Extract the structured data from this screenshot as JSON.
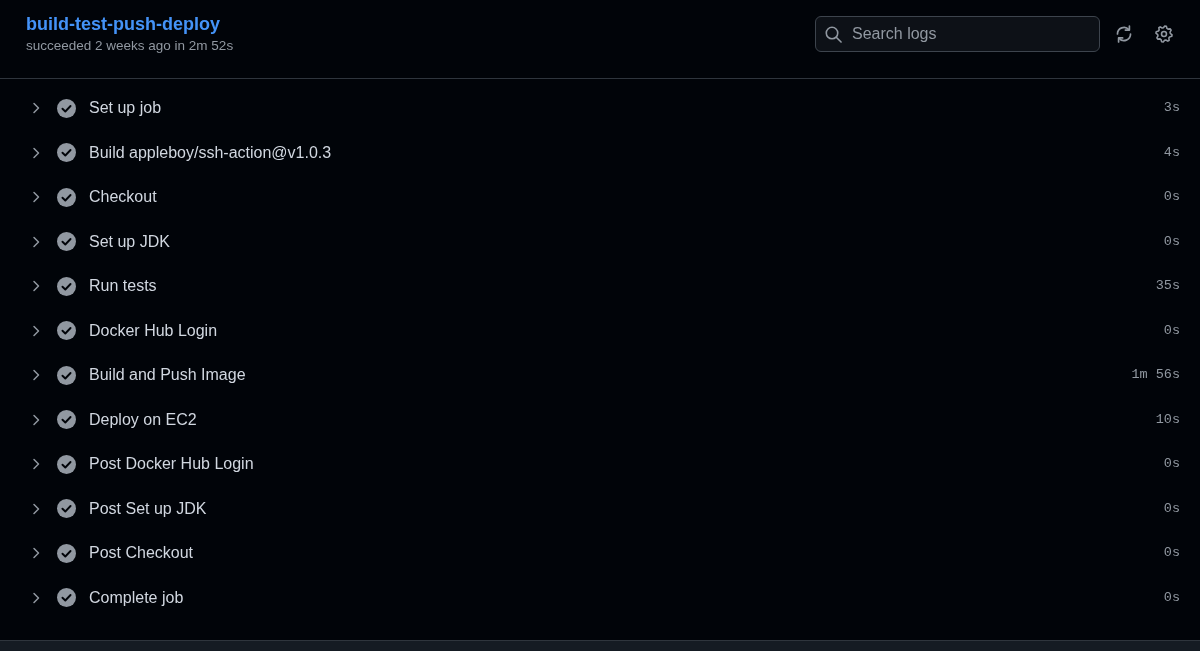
{
  "job": {
    "title": "build-test-push-deploy",
    "summary": "succeeded 2 weeks ago in 2m 52s"
  },
  "search": {
    "placeholder": "Search logs"
  },
  "steps": [
    {
      "name": "Set up job",
      "duration": "3s",
      "succeeded": true,
      "expanded": false
    },
    {
      "name": "Build appleboy/ssh-action@v1.0.3",
      "duration": "4s",
      "succeeded": true,
      "expanded": false
    },
    {
      "name": "Checkout",
      "duration": "0s",
      "succeeded": true,
      "expanded": false
    },
    {
      "name": "Set up JDK",
      "duration": "0s",
      "succeeded": true,
      "expanded": false
    },
    {
      "name": "Run tests",
      "duration": "35s",
      "succeeded": true,
      "expanded": false
    },
    {
      "name": "Docker Hub Login",
      "duration": "0s",
      "succeeded": true,
      "expanded": false
    },
    {
      "name": "Build and Push Image",
      "duration": "1m 56s",
      "succeeded": true,
      "expanded": false
    },
    {
      "name": "Deploy on EC2",
      "duration": "10s",
      "succeeded": true,
      "expanded": false
    },
    {
      "name": "Post Docker Hub Login",
      "duration": "0s",
      "succeeded": true,
      "expanded": false
    },
    {
      "name": "Post Set up JDK",
      "duration": "0s",
      "succeeded": true,
      "expanded": false
    },
    {
      "name": "Post Checkout",
      "duration": "0s",
      "succeeded": true,
      "expanded": false
    },
    {
      "name": "Complete job",
      "duration": "0s",
      "succeeded": true,
      "expanded": false
    }
  ]
}
